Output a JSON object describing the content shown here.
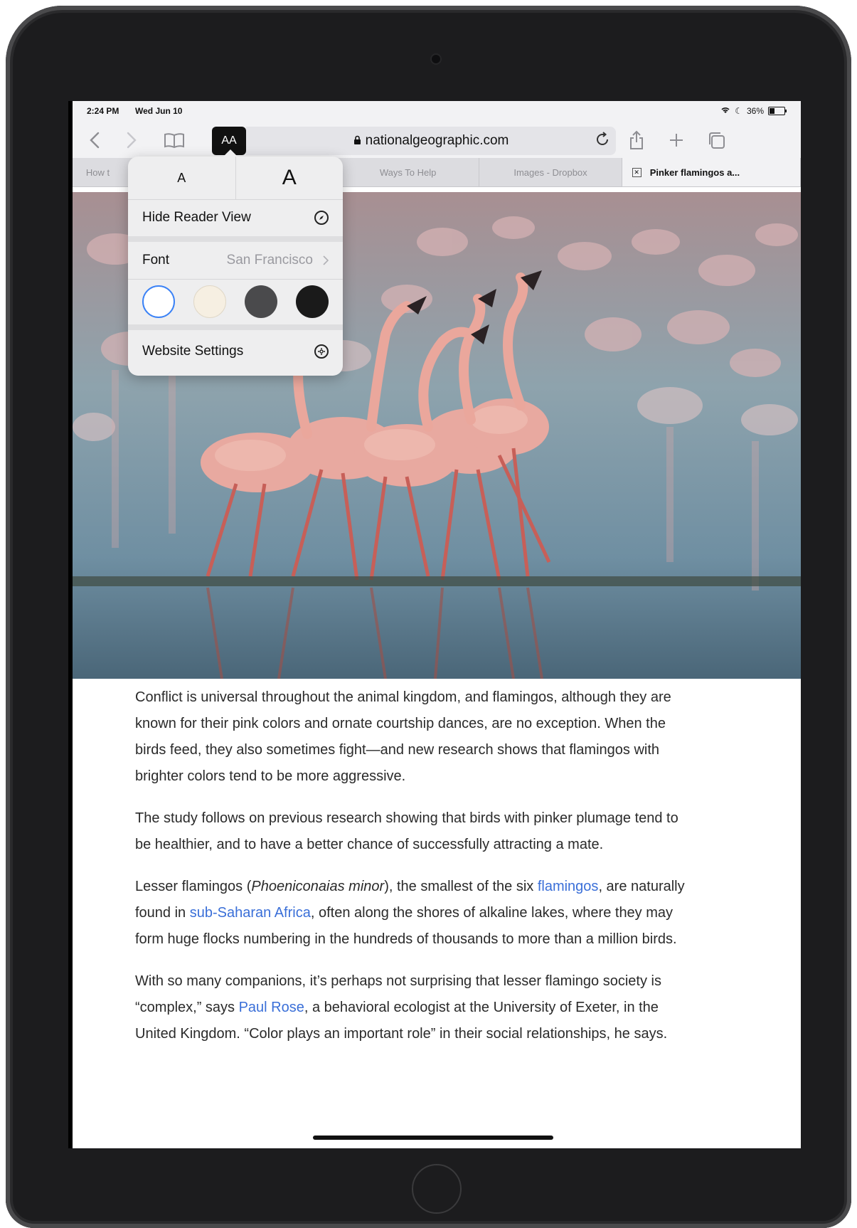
{
  "status_bar": {
    "time": "2:24 PM",
    "date": "Wed Jun 10",
    "battery": "36%"
  },
  "toolbar": {
    "reader_button_label": "AA",
    "url": "nationalgeographic.com"
  },
  "tabs": [
    {
      "label": "How t"
    },
    {
      "label": "Ways To Help"
    },
    {
      "label": "Images - Dropbox"
    },
    {
      "label": "Pinker flamingos a..."
    }
  ],
  "reader_popover": {
    "font_smaller": "A",
    "font_larger": "A",
    "hide_reader_view": "Hide Reader View",
    "font_label": "Font",
    "font_value": "San Francisco",
    "website_settings": "Website Settings",
    "themes": [
      "#ffffff",
      "#f6efe2",
      "#4a4a4c",
      "#1a1a1a"
    ]
  },
  "article": {
    "p1": "Conflict is universal throughout the animal kingdom, and flamingos, although they are known for their pink colors and ornate courtship dances, are no exception. When the birds feed, they also sometimes fight—and new research shows that flamingos with brighter colors tend to be more aggressive.",
    "p2": "The study follows on previous research showing that birds with pinker plumage tend to be healthier, and to have a better chance of successfully attracting a mate.",
    "p3_a": "Lesser flamingos (",
    "p3_species": "Phoeniconaias minor",
    "p3_b": "), the smallest of the six ",
    "p3_link1": "flamingos",
    "p3_c": ", are naturally found in ",
    "p3_link2": "sub-Saharan Africa",
    "p3_d": ", often along the shores of alkaline lakes, where they may form huge flocks numbering in the hundreds of thousands to more than a million birds.",
    "p4_a": "With so many companions, it’s perhaps not surprising that lesser flamingo society is “complex,” says ",
    "p4_link": "Paul Rose",
    "p4_b": ", a behavioral ecologist at the University of Exeter, in the United Kingdom. “Color plays an important role” in their social relationships, he says."
  },
  "colors": {
    "link": "#3a6fd8",
    "accent": "#111111"
  }
}
